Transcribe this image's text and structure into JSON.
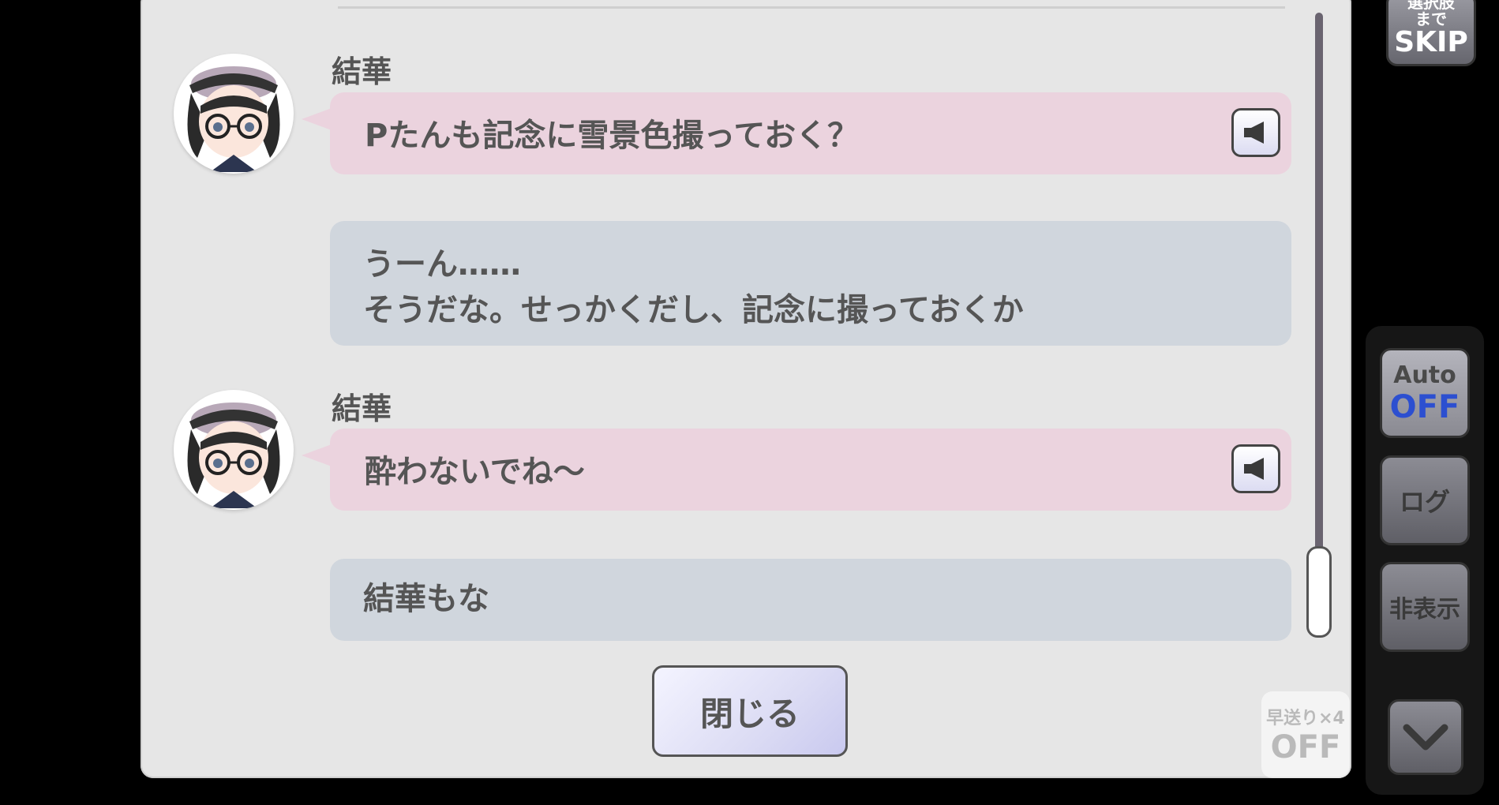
{
  "log": {
    "entries": [
      {
        "speaker": "結華",
        "text": "Pたんも記念に雪景色撮っておく？",
        "type": "character"
      },
      {
        "speaker": "",
        "line1": "うーん……",
        "line2": "そうだな。せっかくだし、記念に撮っておくか",
        "type": "producer"
      },
      {
        "speaker": "結華",
        "text": "酔わないでね～",
        "type": "character"
      },
      {
        "speaker": "",
        "text": "結華もな",
        "type": "producer"
      }
    ],
    "close_label": "閉じる"
  },
  "controls": {
    "skip": {
      "line1": "選択肢",
      "line2": "まで",
      "line3": "SKIP"
    },
    "auto": {
      "label": "Auto",
      "state": "OFF"
    },
    "log_label": "ログ",
    "hide_label": "非表示",
    "fast_forward": {
      "label": "早送り×4",
      "state": "OFF"
    }
  },
  "colors": {
    "character_bubble": "#ebd3de",
    "producer_bubble": "#d0d6dd",
    "auto_off": "#2c4fd0"
  }
}
